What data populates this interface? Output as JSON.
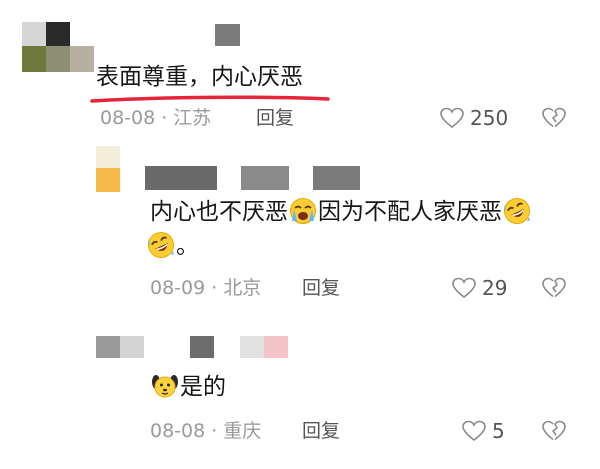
{
  "comments": [
    {
      "text": "表面尊重，内心厌恶",
      "date": "08-08",
      "location": "江苏",
      "reply_label": "回复",
      "like_count": "250"
    },
    {
      "text_line1_a": "内心也不厌恶",
      "text_line1_b": "因为不配人家厌恶",
      "text_line2": "。",
      "date": "08-09",
      "location": "北京",
      "reply_label": "回复",
      "like_count": "29"
    },
    {
      "text": "是的",
      "date": "08-08",
      "location": "重庆",
      "reply_label": "回复",
      "like_count": "5"
    }
  ],
  "icons": {
    "like": "heart-outline-icon",
    "dislike": "broken-heart-icon",
    "emoji_cry": "crying-face-emoji",
    "emoji_laugh": "rolling-laughing-emoji",
    "emoji_dog": "dog-face-emoji"
  },
  "colors": {
    "underline": "#e8243a",
    "meta_text": "#9a9a9a",
    "reply_text": "#555555"
  }
}
